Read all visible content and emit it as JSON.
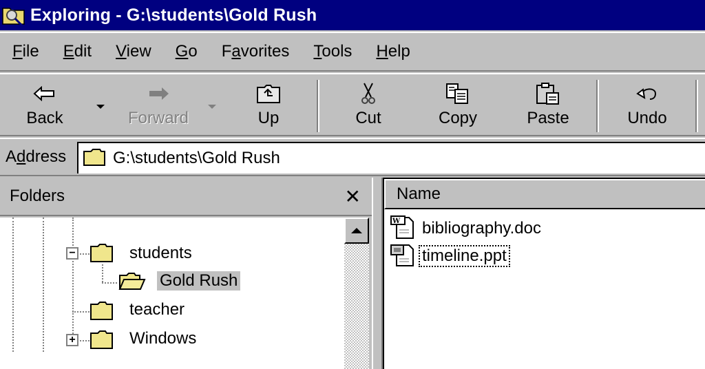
{
  "window": {
    "title": "Exploring - G:\\students\\Gold Rush",
    "title_bar_color": "#000080"
  },
  "menu": {
    "items": [
      {
        "label": "File",
        "accel": "F"
      },
      {
        "label": "Edit",
        "accel": "E"
      },
      {
        "label": "View",
        "accel": "V"
      },
      {
        "label": "Go",
        "accel": "G"
      },
      {
        "label": "Favorites",
        "accel": "a"
      },
      {
        "label": "Tools",
        "accel": "T"
      },
      {
        "label": "Help",
        "accel": "H"
      }
    ]
  },
  "toolbar": {
    "back_label": "Back",
    "forward_label": "Forward",
    "up_label": "Up",
    "cut_label": "Cut",
    "copy_label": "Copy",
    "paste_label": "Paste",
    "undo_label": "Undo",
    "forward_enabled": false
  },
  "address": {
    "label": "Address",
    "value": "G:\\students\\Gold Rush"
  },
  "folders": {
    "title": "Folders",
    "close_glyph": "✕",
    "tree": [
      {
        "label": "students",
        "expander": "−",
        "selected": false
      },
      {
        "label": "Gold Rush",
        "expander": null,
        "selected": true
      },
      {
        "label": "teacher",
        "expander": null,
        "selected": false
      },
      {
        "label": "Windows",
        "expander": "+",
        "selected": false
      }
    ]
  },
  "files": {
    "column_name": "Name",
    "items": [
      {
        "name": "bibliography.doc",
        "type": "word-document",
        "focused": false
      },
      {
        "name": "timeline.ppt",
        "type": "powerpoint-presentation",
        "focused": true
      }
    ]
  }
}
